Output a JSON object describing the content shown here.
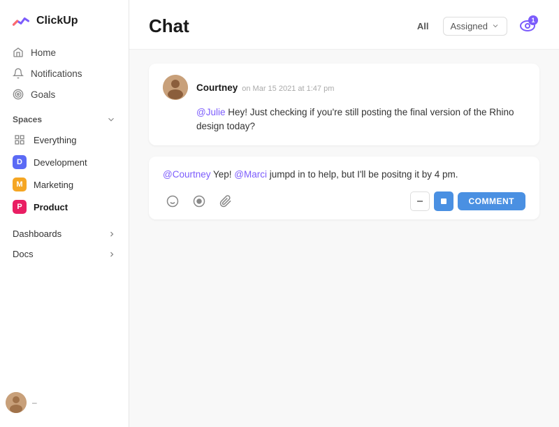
{
  "brand": {
    "name": "ClickUp"
  },
  "sidebar": {
    "nav": [
      {
        "id": "home",
        "label": "Home",
        "icon": "home"
      },
      {
        "id": "notifications",
        "label": "Notifications",
        "icon": "bell"
      },
      {
        "id": "goals",
        "label": "Goals",
        "icon": "target"
      }
    ],
    "spaces_label": "Spaces",
    "spaces": [
      {
        "id": "everything",
        "label": "Everything",
        "type": "everything"
      },
      {
        "id": "development",
        "label": "Development",
        "abbr": "D",
        "type": "development"
      },
      {
        "id": "marketing",
        "label": "Marketing",
        "abbr": "M",
        "type": "marketing"
      },
      {
        "id": "product",
        "label": "Product",
        "abbr": "P",
        "type": "product"
      }
    ],
    "dashboards_label": "Dashboards",
    "docs_label": "Docs"
  },
  "chat": {
    "title": "Chat",
    "filter_all": "All",
    "filter_assigned": "Assigned",
    "notify_count": "1",
    "messages": [
      {
        "id": "msg1",
        "author": "Courtney",
        "timestamp": "on Mar 15 2021 at 1:47 pm",
        "mention": "@Julie",
        "body": " Hey! Just checking if you're still posting the final version of the Rhino design today?"
      }
    ],
    "reply": {
      "mention1": "@Courtney",
      "reply_text": " Yep! ",
      "mention2": "@Marci",
      "reply_rest": " jumpd in to help, but I'll be positng it by 4 pm."
    },
    "toolbar": {
      "comment_label": "COMMENT"
    }
  }
}
